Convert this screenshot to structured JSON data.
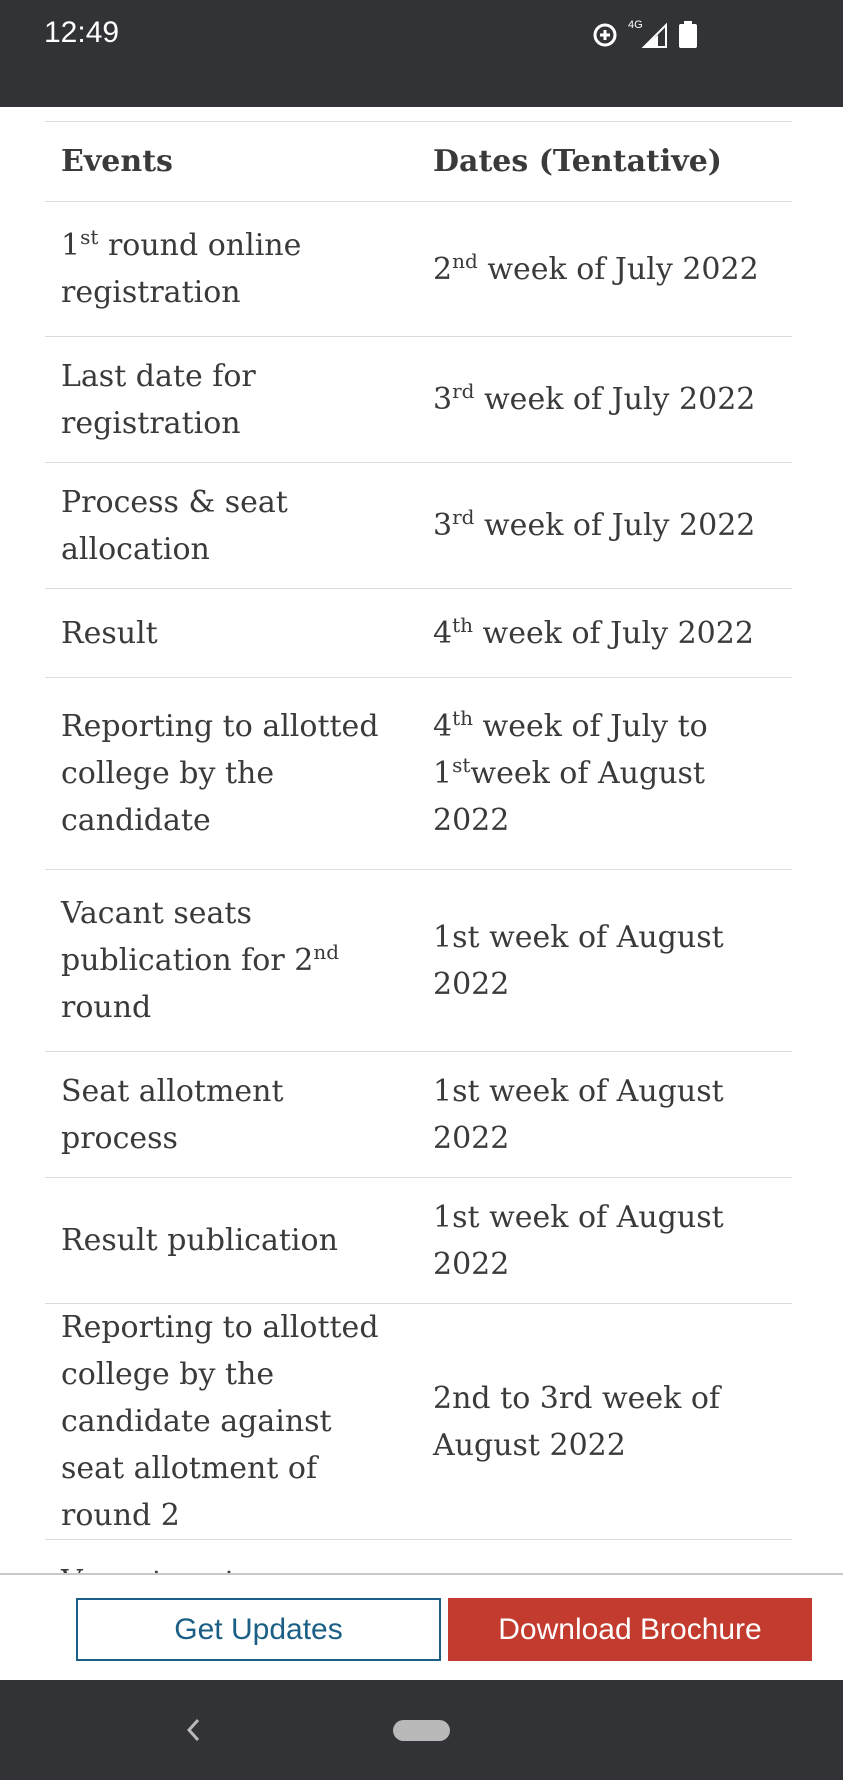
{
  "status_bar": {
    "time": "12:49",
    "network": "4G"
  },
  "table": {
    "headers": [
      "Events",
      "Dates (Tentative)"
    ],
    "rows": [
      {
        "event": [
          [
            "1"
          ],
          [
            "st",
            "sup"
          ],
          [
            " round online registration"
          ]
        ],
        "date": [
          [
            "2"
          ],
          [
            "nd",
            "sup"
          ],
          [
            " week of July 2022"
          ]
        ]
      },
      {
        "event": [
          [
            "Last date for registration"
          ]
        ],
        "date": [
          [
            "3"
          ],
          [
            "rd",
            "sup"
          ],
          [
            " week of July 2022"
          ]
        ]
      },
      {
        "event": [
          [
            "Process & seat allocation"
          ]
        ],
        "date": [
          [
            "3"
          ],
          [
            "rd",
            "sup"
          ],
          [
            " week of July 2022"
          ]
        ]
      },
      {
        "event": [
          [
            "Result"
          ]
        ],
        "date": [
          [
            "4"
          ],
          [
            "th",
            "sup"
          ],
          [
            " week of July 2022"
          ]
        ]
      },
      {
        "event": [
          [
            "Reporting to allotted college by the candidate"
          ]
        ],
        "date": [
          [
            "4"
          ],
          [
            "th",
            "sup"
          ],
          [
            " week of July to 1"
          ],
          [
            "st",
            "sup"
          ],
          [
            "week of August 2022"
          ]
        ]
      },
      {
        "event": [
          [
            "Vacant seats publication for 2"
          ],
          [
            "nd",
            "sup"
          ],
          [
            " round"
          ]
        ],
        "date": [
          [
            "1st week of August 2022"
          ]
        ]
      },
      {
        "event": [
          [
            "Seat allotment process"
          ]
        ],
        "date": [
          [
            "1st week of August 2022"
          ]
        ]
      },
      {
        "event": [
          [
            "Result publication"
          ]
        ],
        "date": [
          [
            "1st week of August 2022"
          ]
        ]
      },
      {
        "event": [
          [
            "Reporting to allotted college by the candidate against seat allotment of round 2"
          ]
        ],
        "date": [
          [
            "2nd to 3rd week of August 2022"
          ]
        ]
      },
      {
        "event": [
          [
            "Vacant seats"
          ]
        ],
        "date": [
          [
            ""
          ]
        ]
      }
    ]
  },
  "bottom_bar": {
    "get_updates_label": "Get Updates",
    "download_brochure_label": "Download Brochure"
  },
  "colors": {
    "status_bar": "#323336",
    "updates_border": "#1b5f86",
    "brochure_bg": "#c33a2e"
  }
}
